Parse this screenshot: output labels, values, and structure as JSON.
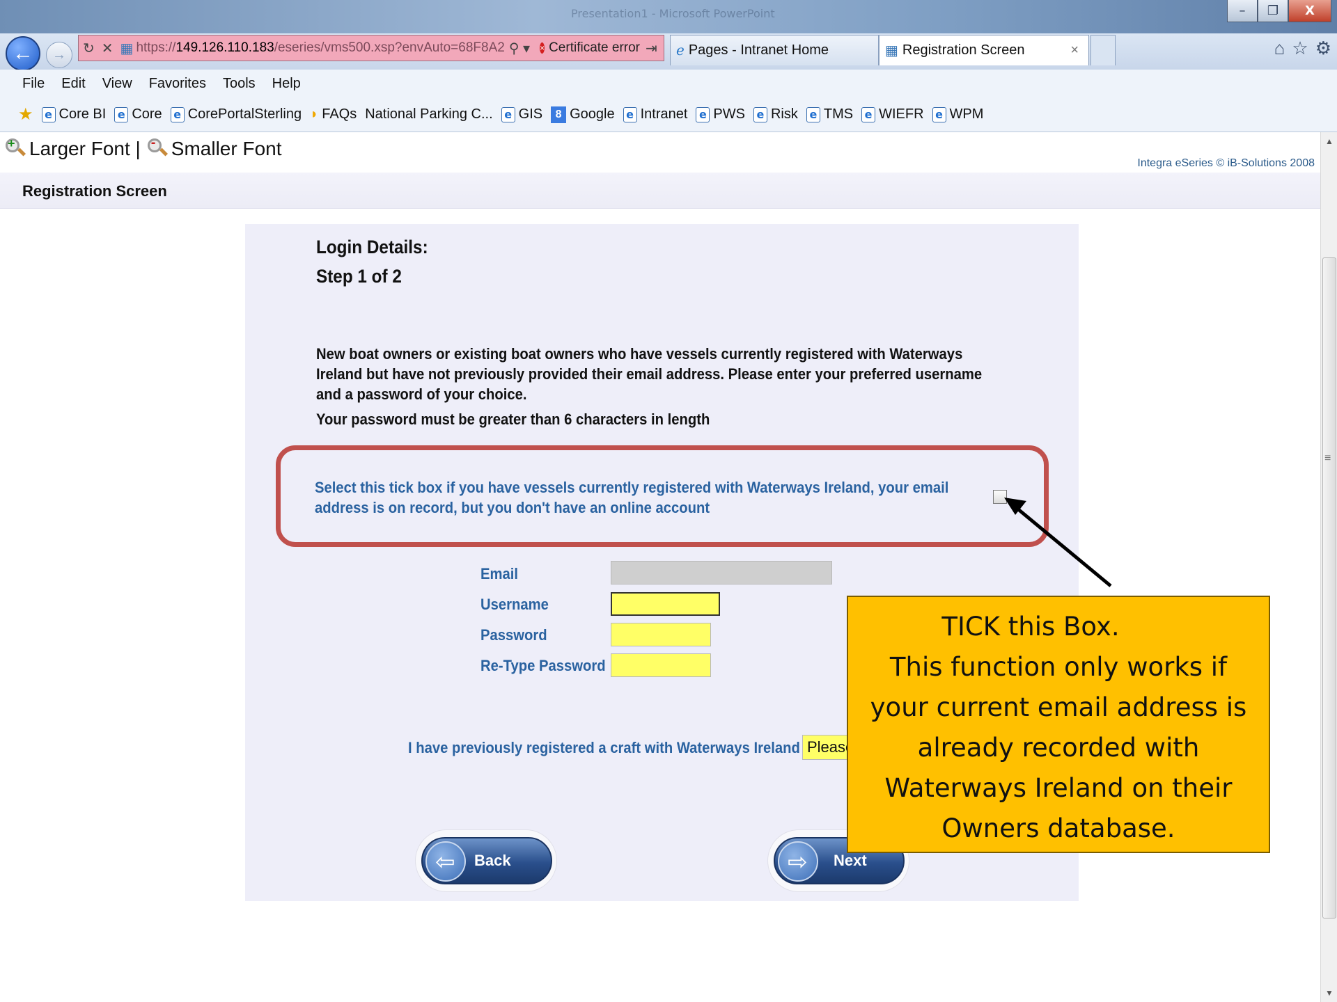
{
  "window": {
    "title": "Presentation1 - Microsoft PowerPoint",
    "minimize": "–",
    "restore": "❐",
    "close": "X"
  },
  "nav": {
    "address_prefix": "https://",
    "address_host": "149.126.110.183",
    "address_path": "/eseries/vms500.xsp?envAuto=68F8A2",
    "search_glyph": "⚲ ▾",
    "cert_error": "Certificate error",
    "go_glyph": "⇥ →",
    "tabs": [
      {
        "label": "Pages - Intranet Home"
      },
      {
        "label": "Registration Screen"
      }
    ],
    "tab_close": "×"
  },
  "menu": [
    "File",
    "Edit",
    "View",
    "Favorites",
    "Tools",
    "Help"
  ],
  "favorites": [
    {
      "label": "Core BI",
      "icon": "ie-page-icon"
    },
    {
      "label": "Core",
      "icon": "ie-page-icon"
    },
    {
      "label": "CorePortalSterling",
      "icon": "ie-page-icon"
    },
    {
      "label": "FAQs",
      "icon": "faq-icon"
    },
    {
      "label": "National Parking C...",
      "icon": "none"
    },
    {
      "label": "GIS",
      "icon": "ie-page-icon"
    },
    {
      "label": "Google",
      "icon": "google-icon"
    },
    {
      "label": "Intranet",
      "icon": "ie-page-icon"
    },
    {
      "label": "PWS",
      "icon": "ie-page-icon"
    },
    {
      "label": "Risk",
      "icon": "ie-page-icon"
    },
    {
      "label": "TMS",
      "icon": "ie-page-icon"
    },
    {
      "label": "WIEFR",
      "icon": "ie-page-icon"
    },
    {
      "label": "WPM",
      "icon": "ie-page-icon"
    }
  ],
  "page": {
    "larger_font": "Larger Font |",
    "smaller_font": "Smaller Font",
    "copyright": "Integra eSeries © iB-Solutions 2008",
    "screen_title": "Registration Screen",
    "heading": "Login Details:",
    "step": "Step 1 of 2",
    "intro": "New boat owners or existing boat owners who have vessels currently registered with Waterways Ireland but have not previously provided their email address. Please enter your preferred username and a password of your choice.",
    "password_rule": "Your password must be greater than 6 characters in length",
    "tick_text": "Select this tick box if you have vessels currently registered with Waterways Ireland, your email address is on record, but you don't have an online account",
    "fields": {
      "email": {
        "label": "Email",
        "value": ""
      },
      "username": {
        "label": "Username",
        "value": ""
      },
      "password": {
        "label": "Password",
        "value": ""
      },
      "retype": {
        "label": "Re-Type Password",
        "value": ""
      }
    },
    "previous_label": "I have previously registered a craft with Waterways Ireland",
    "previous_value": "Please",
    "back_label": "Back",
    "next_label": "Next"
  },
  "callout": {
    "lines": [
      "TICK this Box.",
      "This function only works if",
      "your current email address is",
      "already recorded with",
      "Waterways Ireland on their",
      "Owners database."
    ]
  },
  "colors": {
    "address_bar": "#f2a8ba",
    "highlight_frame": "#c0504d",
    "callout_fill": "#ffc000",
    "field_label": "#2a62a0",
    "required_field": "#ffff66"
  }
}
